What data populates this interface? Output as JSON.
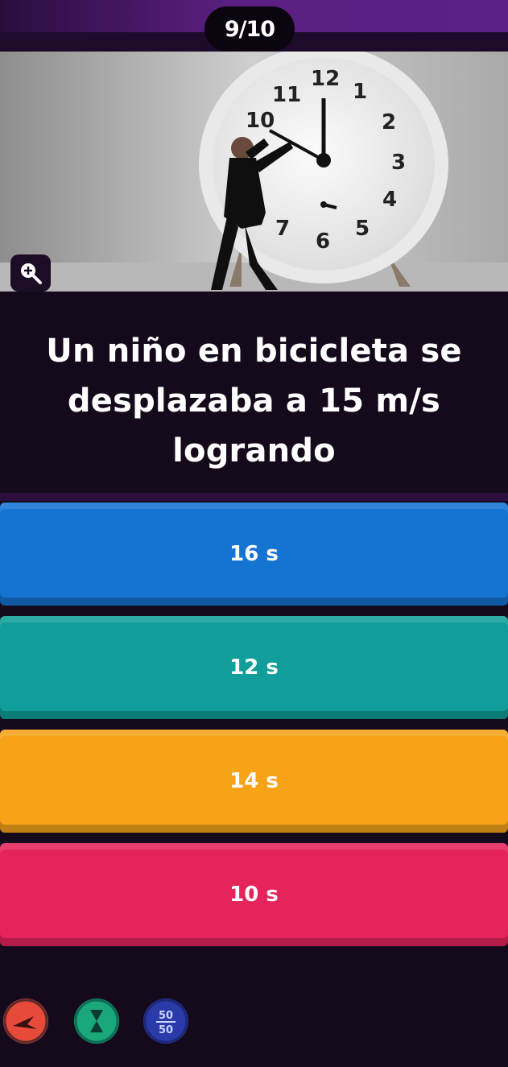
{
  "header": {
    "progress": "9/10"
  },
  "question_image": {
    "icon": "clock-photo",
    "zoom_icon": "zoom-in-icon"
  },
  "question": {
    "line1": "Un niño en bicicleta se",
    "line2": "desplazaba a 15 m/s",
    "line3": "logrando"
  },
  "answers": [
    {
      "label": "16 s",
      "color": "#1574d2"
    },
    {
      "label": "12 s",
      "color": "#119e9a"
    },
    {
      "label": "14 s",
      "color": "#f6a318"
    },
    {
      "label": "10 s",
      "color": "#e4245a"
    }
  ],
  "powerups": {
    "fifty_fifty_label_top": "50",
    "fifty_fifty_label_bottom": "50"
  }
}
